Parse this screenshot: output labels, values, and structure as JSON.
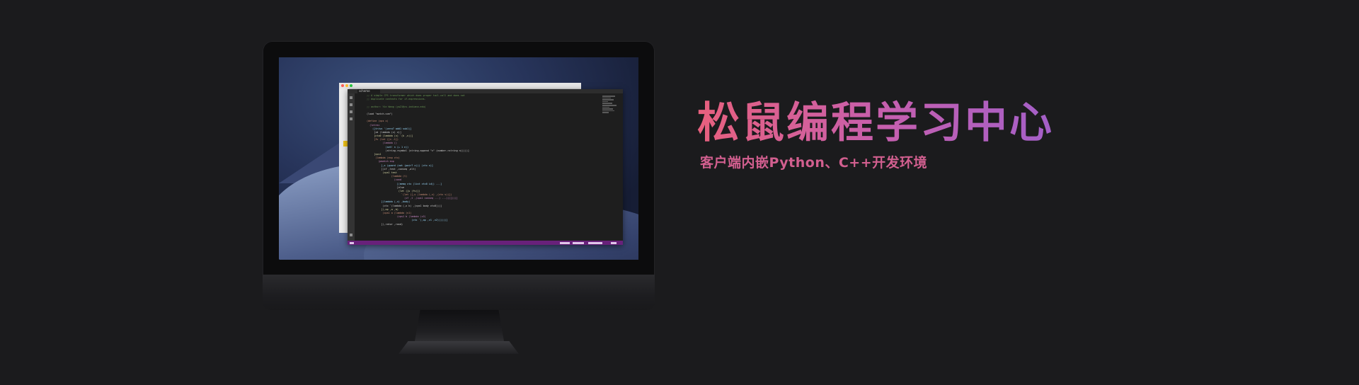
{
  "headline": {
    "title": "松鼠编程学习中心",
    "subtitle": "客户端内嵌Python、C++开发环境"
  },
  "colors": {
    "background": "#1b1b1d",
    "title_gradient_start": "#e8607e",
    "title_gradient_end": "#a35fc8",
    "subtitle": "#d25f8f",
    "editor_status_bar": "#68217a"
  },
  "editor": {
    "tab_label": "scheme",
    "code_lines": [
      ";; A simple CPS transformer which does proper tail-call and does not",
      ";; duplicate contexts for if-expressions.",
      "",
      ";; author: Yin Wang (yw21@cs.indiana.edu)",
      "",
      "(load \"match.scm\")",
      "",
      "(define (cps x)",
      "  (letrec",
      "    ([trivs '(zero? add1 sub1)]",
      "     [id (lambda (v) v)]",
      "     [ctx0 (lambda (v) `(k ,v))]",
      "     [fv (let ([n -1])",
      "           (lambda ()",
      "             (set! n (+ 1 n))",
      "             (string->symbol (string-append \"v\" (number->string n)))))]",
      "     [cps1",
      "      (lambda (exp ctx)",
      "        (pmatch exp",
      "          [,x (guard (not (pair? x))) (ctx x)]",
      "          [(if ,test ,conseq ,alt)",
      "           (cps1 test",
      "                 (lambda (t)",
      "                   (cond",
      "                     [(memq ctx (list ctx0 id)) ...]",
      "                     [else",
      "                      (let ([u (fv)])",
      "                        `(let ([,u (lambda (,v) ,(ctx v))])",
      "                          (if ,t ,(cps1 conseq ...) ...)))])))]",
      "          [(lambda (,x) ,body)",
      "           (ctx `(lambda (,x k) ,(cps1 body ctx0)))]",
      "          [(,op ,a ,b)",
      "           (cps1 a (lambda (v1)",
      "                     (cps1 b (lambda (v2)",
      "                               (ctx `(,op ,v1 ,v2))))))]",
      "          [(,rator ,rand)"
    ]
  }
}
